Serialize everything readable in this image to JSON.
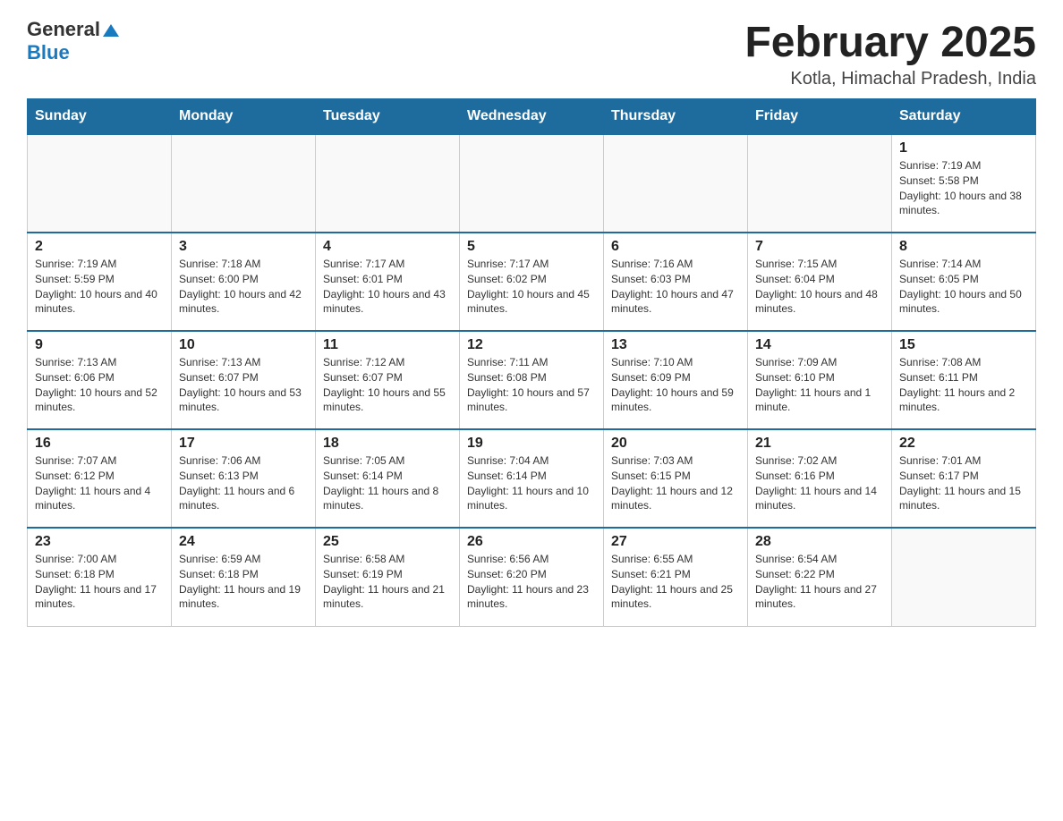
{
  "header": {
    "logo_general": "General",
    "logo_blue": "Blue",
    "title": "February 2025",
    "location": "Kotla, Himachal Pradesh, India"
  },
  "weekdays": [
    "Sunday",
    "Monday",
    "Tuesday",
    "Wednesday",
    "Thursday",
    "Friday",
    "Saturday"
  ],
  "weeks": [
    [
      {
        "day": "",
        "sunrise": "",
        "sunset": "",
        "daylight": ""
      },
      {
        "day": "",
        "sunrise": "",
        "sunset": "",
        "daylight": ""
      },
      {
        "day": "",
        "sunrise": "",
        "sunset": "",
        "daylight": ""
      },
      {
        "day": "",
        "sunrise": "",
        "sunset": "",
        "daylight": ""
      },
      {
        "day": "",
        "sunrise": "",
        "sunset": "",
        "daylight": ""
      },
      {
        "day": "",
        "sunrise": "",
        "sunset": "",
        "daylight": ""
      },
      {
        "day": "1",
        "sunrise": "Sunrise: 7:19 AM",
        "sunset": "Sunset: 5:58 PM",
        "daylight": "Daylight: 10 hours and 38 minutes."
      }
    ],
    [
      {
        "day": "2",
        "sunrise": "Sunrise: 7:19 AM",
        "sunset": "Sunset: 5:59 PM",
        "daylight": "Daylight: 10 hours and 40 minutes."
      },
      {
        "day": "3",
        "sunrise": "Sunrise: 7:18 AM",
        "sunset": "Sunset: 6:00 PM",
        "daylight": "Daylight: 10 hours and 42 minutes."
      },
      {
        "day": "4",
        "sunrise": "Sunrise: 7:17 AM",
        "sunset": "Sunset: 6:01 PM",
        "daylight": "Daylight: 10 hours and 43 minutes."
      },
      {
        "day": "5",
        "sunrise": "Sunrise: 7:17 AM",
        "sunset": "Sunset: 6:02 PM",
        "daylight": "Daylight: 10 hours and 45 minutes."
      },
      {
        "day": "6",
        "sunrise": "Sunrise: 7:16 AM",
        "sunset": "Sunset: 6:03 PM",
        "daylight": "Daylight: 10 hours and 47 minutes."
      },
      {
        "day": "7",
        "sunrise": "Sunrise: 7:15 AM",
        "sunset": "Sunset: 6:04 PM",
        "daylight": "Daylight: 10 hours and 48 minutes."
      },
      {
        "day": "8",
        "sunrise": "Sunrise: 7:14 AM",
        "sunset": "Sunset: 6:05 PM",
        "daylight": "Daylight: 10 hours and 50 minutes."
      }
    ],
    [
      {
        "day": "9",
        "sunrise": "Sunrise: 7:13 AM",
        "sunset": "Sunset: 6:06 PM",
        "daylight": "Daylight: 10 hours and 52 minutes."
      },
      {
        "day": "10",
        "sunrise": "Sunrise: 7:13 AM",
        "sunset": "Sunset: 6:07 PM",
        "daylight": "Daylight: 10 hours and 53 minutes."
      },
      {
        "day": "11",
        "sunrise": "Sunrise: 7:12 AM",
        "sunset": "Sunset: 6:07 PM",
        "daylight": "Daylight: 10 hours and 55 minutes."
      },
      {
        "day": "12",
        "sunrise": "Sunrise: 7:11 AM",
        "sunset": "Sunset: 6:08 PM",
        "daylight": "Daylight: 10 hours and 57 minutes."
      },
      {
        "day": "13",
        "sunrise": "Sunrise: 7:10 AM",
        "sunset": "Sunset: 6:09 PM",
        "daylight": "Daylight: 10 hours and 59 minutes."
      },
      {
        "day": "14",
        "sunrise": "Sunrise: 7:09 AM",
        "sunset": "Sunset: 6:10 PM",
        "daylight": "Daylight: 11 hours and 1 minute."
      },
      {
        "day": "15",
        "sunrise": "Sunrise: 7:08 AM",
        "sunset": "Sunset: 6:11 PM",
        "daylight": "Daylight: 11 hours and 2 minutes."
      }
    ],
    [
      {
        "day": "16",
        "sunrise": "Sunrise: 7:07 AM",
        "sunset": "Sunset: 6:12 PM",
        "daylight": "Daylight: 11 hours and 4 minutes."
      },
      {
        "day": "17",
        "sunrise": "Sunrise: 7:06 AM",
        "sunset": "Sunset: 6:13 PM",
        "daylight": "Daylight: 11 hours and 6 minutes."
      },
      {
        "day": "18",
        "sunrise": "Sunrise: 7:05 AM",
        "sunset": "Sunset: 6:14 PM",
        "daylight": "Daylight: 11 hours and 8 minutes."
      },
      {
        "day": "19",
        "sunrise": "Sunrise: 7:04 AM",
        "sunset": "Sunset: 6:14 PM",
        "daylight": "Daylight: 11 hours and 10 minutes."
      },
      {
        "day": "20",
        "sunrise": "Sunrise: 7:03 AM",
        "sunset": "Sunset: 6:15 PM",
        "daylight": "Daylight: 11 hours and 12 minutes."
      },
      {
        "day": "21",
        "sunrise": "Sunrise: 7:02 AM",
        "sunset": "Sunset: 6:16 PM",
        "daylight": "Daylight: 11 hours and 14 minutes."
      },
      {
        "day": "22",
        "sunrise": "Sunrise: 7:01 AM",
        "sunset": "Sunset: 6:17 PM",
        "daylight": "Daylight: 11 hours and 15 minutes."
      }
    ],
    [
      {
        "day": "23",
        "sunrise": "Sunrise: 7:00 AM",
        "sunset": "Sunset: 6:18 PM",
        "daylight": "Daylight: 11 hours and 17 minutes."
      },
      {
        "day": "24",
        "sunrise": "Sunrise: 6:59 AM",
        "sunset": "Sunset: 6:18 PM",
        "daylight": "Daylight: 11 hours and 19 minutes."
      },
      {
        "day": "25",
        "sunrise": "Sunrise: 6:58 AM",
        "sunset": "Sunset: 6:19 PM",
        "daylight": "Daylight: 11 hours and 21 minutes."
      },
      {
        "day": "26",
        "sunrise": "Sunrise: 6:56 AM",
        "sunset": "Sunset: 6:20 PM",
        "daylight": "Daylight: 11 hours and 23 minutes."
      },
      {
        "day": "27",
        "sunrise": "Sunrise: 6:55 AM",
        "sunset": "Sunset: 6:21 PM",
        "daylight": "Daylight: 11 hours and 25 minutes."
      },
      {
        "day": "28",
        "sunrise": "Sunrise: 6:54 AM",
        "sunset": "Sunset: 6:22 PM",
        "daylight": "Daylight: 11 hours and 27 minutes."
      },
      {
        "day": "",
        "sunrise": "",
        "sunset": "",
        "daylight": ""
      }
    ]
  ]
}
